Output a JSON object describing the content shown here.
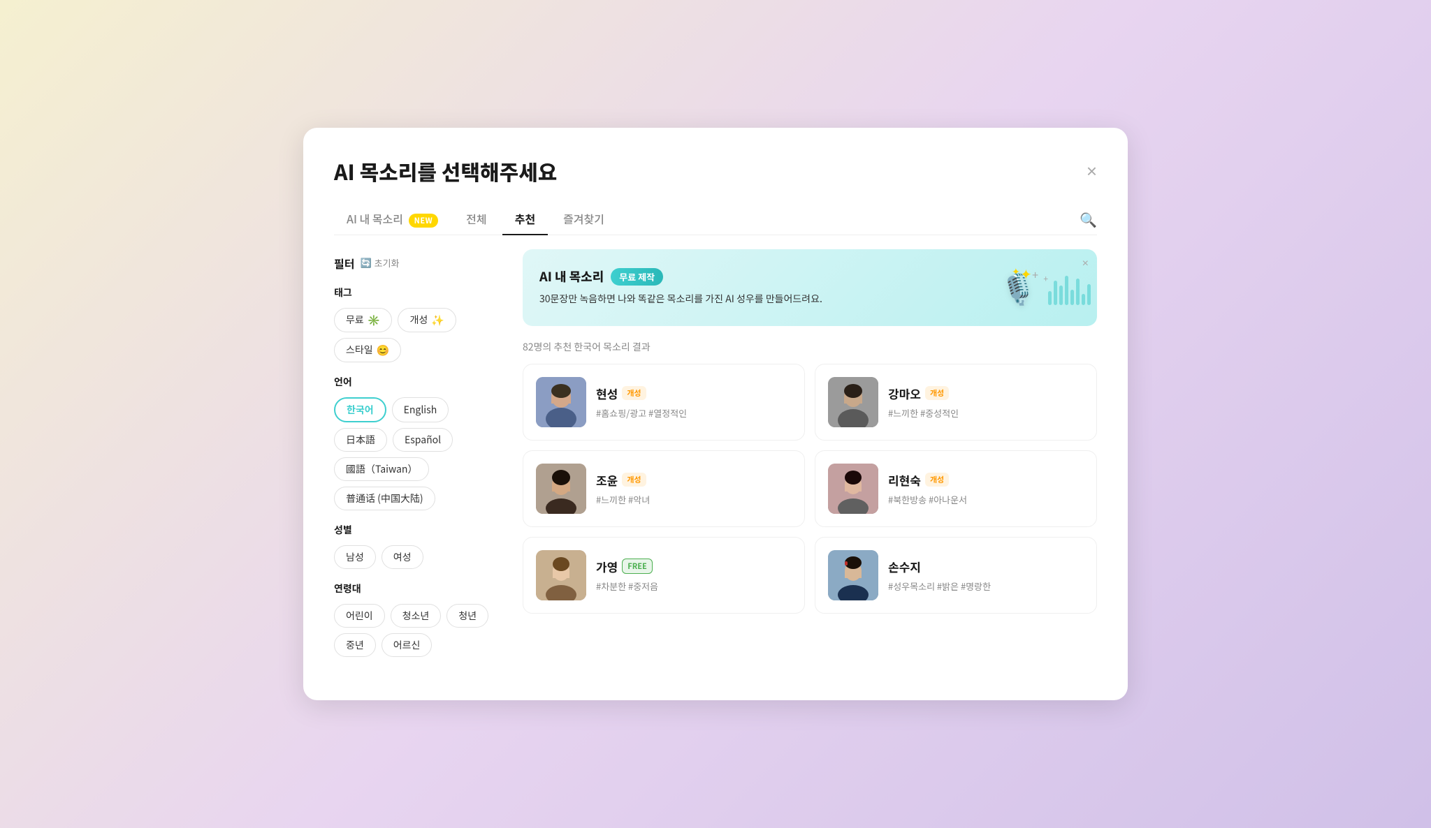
{
  "modal": {
    "title": "AI 목소리를 선택해주세요",
    "close_label": "×"
  },
  "tabs": [
    {
      "id": "my-voice",
      "label": "AI 내 목소리",
      "badge": "NEW",
      "active": false
    },
    {
      "id": "all",
      "label": "전체",
      "active": false
    },
    {
      "id": "recommended",
      "label": "추천",
      "active": true
    },
    {
      "id": "favorites",
      "label": "즐겨찾기",
      "active": false
    }
  ],
  "filter": {
    "title": "필터",
    "reset_label": "초기화",
    "sections": {
      "tag": {
        "label": "태그",
        "chips": [
          {
            "id": "free",
            "label": "무료",
            "icon": "✳️"
          },
          {
            "id": "personality",
            "label": "개성",
            "icon": "✨"
          },
          {
            "id": "style",
            "label": "스타일",
            "icon": "😊"
          }
        ]
      },
      "language": {
        "label": "언어",
        "chips": [
          {
            "id": "korean",
            "label": "한국어",
            "active": true
          },
          {
            "id": "english",
            "label": "English",
            "active": false
          },
          {
            "id": "japanese",
            "label": "日本語",
            "active": false
          },
          {
            "id": "spanish",
            "label": "Español",
            "active": false
          },
          {
            "id": "taiwanese",
            "label": "國語（Taiwan）",
            "active": false
          },
          {
            "id": "chinese",
            "label": "普通话 (中国大陆)",
            "active": false
          }
        ]
      },
      "gender": {
        "label": "성별",
        "chips": [
          {
            "id": "male",
            "label": "남성"
          },
          {
            "id": "female",
            "label": "여성"
          }
        ]
      },
      "age": {
        "label": "연령대",
        "chips": [
          {
            "id": "child",
            "label": "어린이"
          },
          {
            "id": "teen",
            "label": "청소년"
          },
          {
            "id": "young",
            "label": "청년"
          },
          {
            "id": "middle",
            "label": "중년"
          },
          {
            "id": "elder",
            "label": "어르신"
          }
        ]
      }
    }
  },
  "banner": {
    "title": "AI 내 목소리",
    "badge": "무료 제작",
    "description": "30문장만 녹음하면 나와 똑같은 목소리를 가진 AI 성우를 만들어드려요.",
    "close_label": "×"
  },
  "results": {
    "count_text": "82명의 추천 한국어 목소리 결과"
  },
  "voices": [
    {
      "id": "hyeonseong",
      "name": "현성",
      "badge": "개성",
      "badge_type": "personality",
      "tags": "#홈쇼핑/광고 #열정적인",
      "face_class": "face-hyeonseong"
    },
    {
      "id": "gangmao",
      "name": "강마오",
      "badge": "개성",
      "badge_type": "personality",
      "tags": "#느끼한 #중성적인",
      "face_class": "face-gangmao"
    },
    {
      "id": "joyun",
      "name": "조윤",
      "badge": "개성",
      "badge_type": "personality",
      "tags": "#느끼한 #악녀",
      "face_class": "face-joyun"
    },
    {
      "id": "lihyunsuk",
      "name": "리현숙",
      "badge": "개성",
      "badge_type": "personality",
      "tags": "#북한방송 #아나운서",
      "face_class": "face-lihyunsuk"
    },
    {
      "id": "gayeong",
      "name": "가영",
      "badge": "FREE",
      "badge_type": "free",
      "tags": "#차분한 #중저음",
      "face_class": "face-gayeong"
    },
    {
      "id": "sonsujee",
      "name": "손수지",
      "badge": "",
      "badge_type": "none",
      "tags": "#성우목소리 #밝은 #명랑한",
      "face_class": "face-sonsujee"
    }
  ]
}
